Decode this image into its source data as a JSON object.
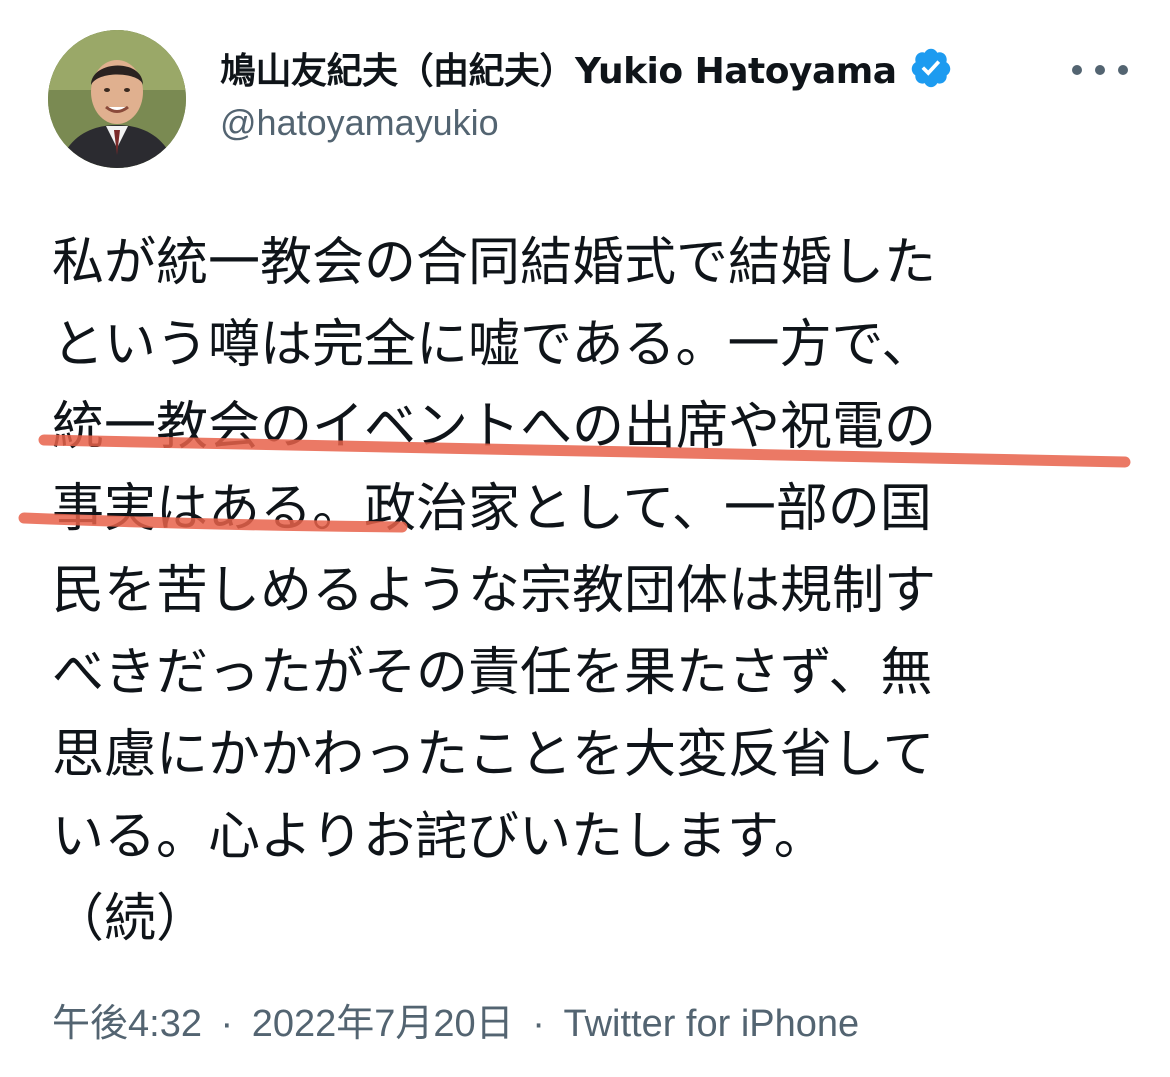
{
  "author": {
    "display_name": "鳩山友紀夫（由紀夫）Yukio Hatoyama",
    "handle": "@hatoyamayukio",
    "verified": true,
    "avatar_icon": "person-portrait-icon"
  },
  "tweet": {
    "lines": [
      "私が統一教会の合同結婚式で結婚した",
      "という噂は完全に嘘である。一方で、",
      "統一教会のイベントへの出席や祝電の",
      "事実はある。政治家として、一部の国",
      "民を苦しめるような宗教団体は規制す",
      "べきだったがその責任を果たさず、無",
      "思慮にかかわったことを大変反省して",
      "いる。心よりお詫びいたします。",
      "（続）"
    ]
  },
  "meta": {
    "time": "午後4:32",
    "separator": "·",
    "date": "2022年7月20日",
    "source": "Twitter for iPhone"
  },
  "colors": {
    "verified_badge": "#1d9bf0",
    "handle_text": "#536471",
    "highlight_stroke": "#e8614a"
  },
  "icons": {
    "more": "more-horizontal-icon",
    "verified": "verified-badge-icon"
  }
}
